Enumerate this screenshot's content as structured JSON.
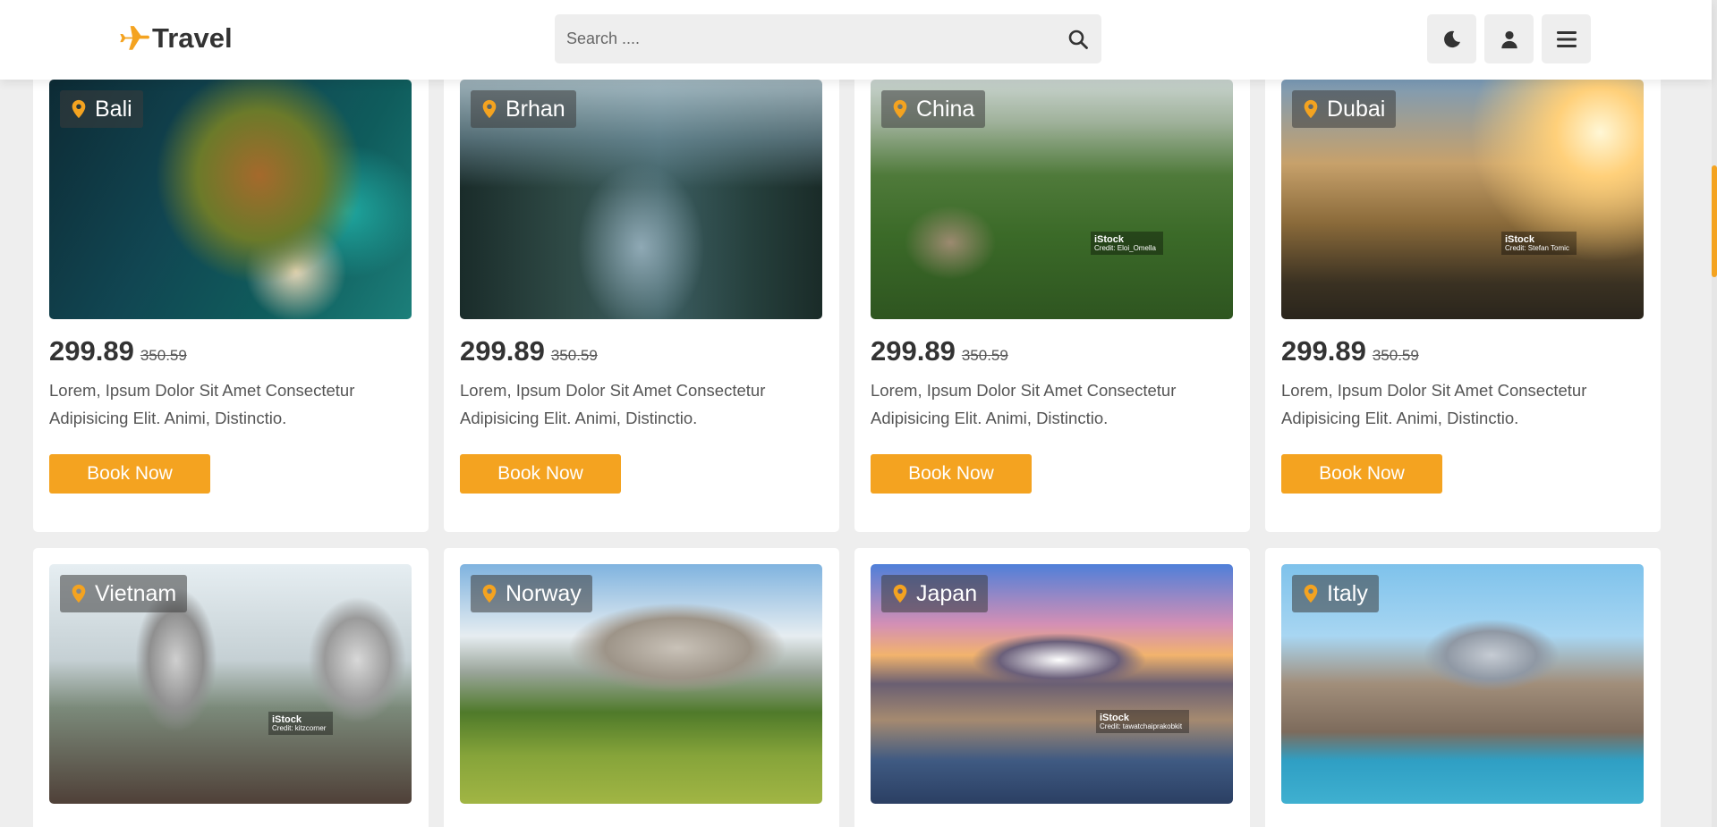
{
  "header": {
    "brand": "Travel",
    "search_placeholder": "Search ....",
    "search_value": ""
  },
  "colors": {
    "accent": "#f4a320",
    "card_bg": "#ffffff",
    "page_bg": "#eeeeee"
  },
  "icons": {
    "logo": "plane-icon",
    "search": "search-icon",
    "theme": "moon-icon",
    "user": "user-icon",
    "menu": "hamburger-menu-icon",
    "location": "map-pin-icon"
  },
  "cards": [
    {
      "location": "Bali",
      "price": "299.89",
      "old_price": "350.59",
      "desc": "Lorem, Ipsum Dolor Sit Amet Consectetur Adipisicing Elit. Animi, Distinctio.",
      "button": "Book Now",
      "credit": "",
      "credit_sub": ""
    },
    {
      "location": "Brhan",
      "price": "299.89",
      "old_price": "350.59",
      "desc": "Lorem, Ipsum Dolor Sit Amet Consectetur Adipisicing Elit. Animi, Distinctio.",
      "button": "Book Now",
      "credit": "",
      "credit_sub": ""
    },
    {
      "location": "China",
      "price": "299.89",
      "old_price": "350.59",
      "desc": "Lorem, Ipsum Dolor Sit Amet Consectetur Adipisicing Elit. Animi, Distinctio.",
      "button": "Book Now",
      "credit": "iStock",
      "credit_sub": "Credit: Eloi_Omella"
    },
    {
      "location": "Dubai",
      "price": "299.89",
      "old_price": "350.59",
      "desc": "Lorem, Ipsum Dolor Sit Amet Consectetur Adipisicing Elit. Animi, Distinctio.",
      "button": "Book Now",
      "credit": "iStock",
      "credit_sub": "Credit: Stefan Tomic"
    },
    {
      "location": "Vietnam",
      "credit": "iStock",
      "credit_sub": "Credit: kitzcorner"
    },
    {
      "location": "Norway",
      "credit": "",
      "credit_sub": ""
    },
    {
      "location": "Japan",
      "credit": "iStock",
      "credit_sub": "Credit: tawatchaiprakobkit"
    },
    {
      "location": "Italy",
      "credit": "",
      "credit_sub": ""
    }
  ]
}
